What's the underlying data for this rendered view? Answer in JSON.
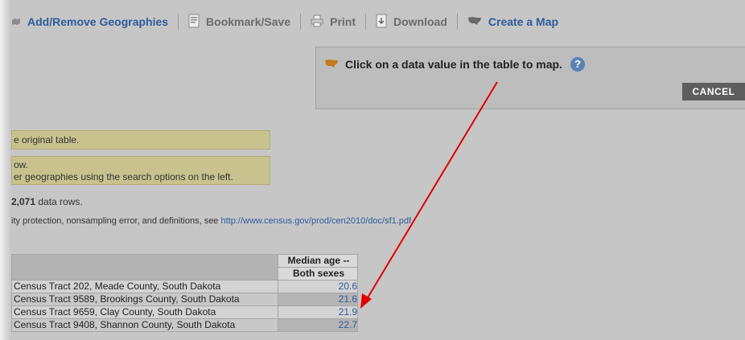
{
  "toolbar": {
    "add_remove_label": "Add/Remove Geographies",
    "bookmark_label": "Bookmark/Save",
    "print_label": "Print",
    "download_label": "Download",
    "create_map_label": "Create a Map"
  },
  "map_panel": {
    "prompt": "Click on a data value in the table to map.",
    "help_glyph": "?",
    "cancel_label": "CANCEL"
  },
  "notes": {
    "note1": "e original table.",
    "note2_line1": "ow.",
    "note2_line2": "er geographies using the search options on the left."
  },
  "row_count": {
    "count": "2,071",
    "suffix": " data rows."
  },
  "source": {
    "text": "ity protection, nonsampling error, and definitions, see ",
    "link": "http://www.census.gov/prod/cen2010/doc/sf1.pdf",
    "end": "."
  },
  "table": {
    "header_top": "Median age --",
    "header_sub": "Both sexes",
    "rows": [
      {
        "geo": "Census Tract 202, Meade County, South Dakota",
        "value": "20.6"
      },
      {
        "geo": "Census Tract 9589, Brookings County, South Dakota",
        "value": "21.6"
      },
      {
        "geo": "Census Tract 9659, Clay County, South Dakota",
        "value": "21.9"
      },
      {
        "geo": "Census Tract 9408, Shannon County, South Dakota",
        "value": "22.7"
      }
    ]
  },
  "colors": {
    "link": "#2f5b9c",
    "arrow": "#e00000",
    "note_bg": "#c8c38e",
    "cancel_bg": "#5e5e5e"
  }
}
